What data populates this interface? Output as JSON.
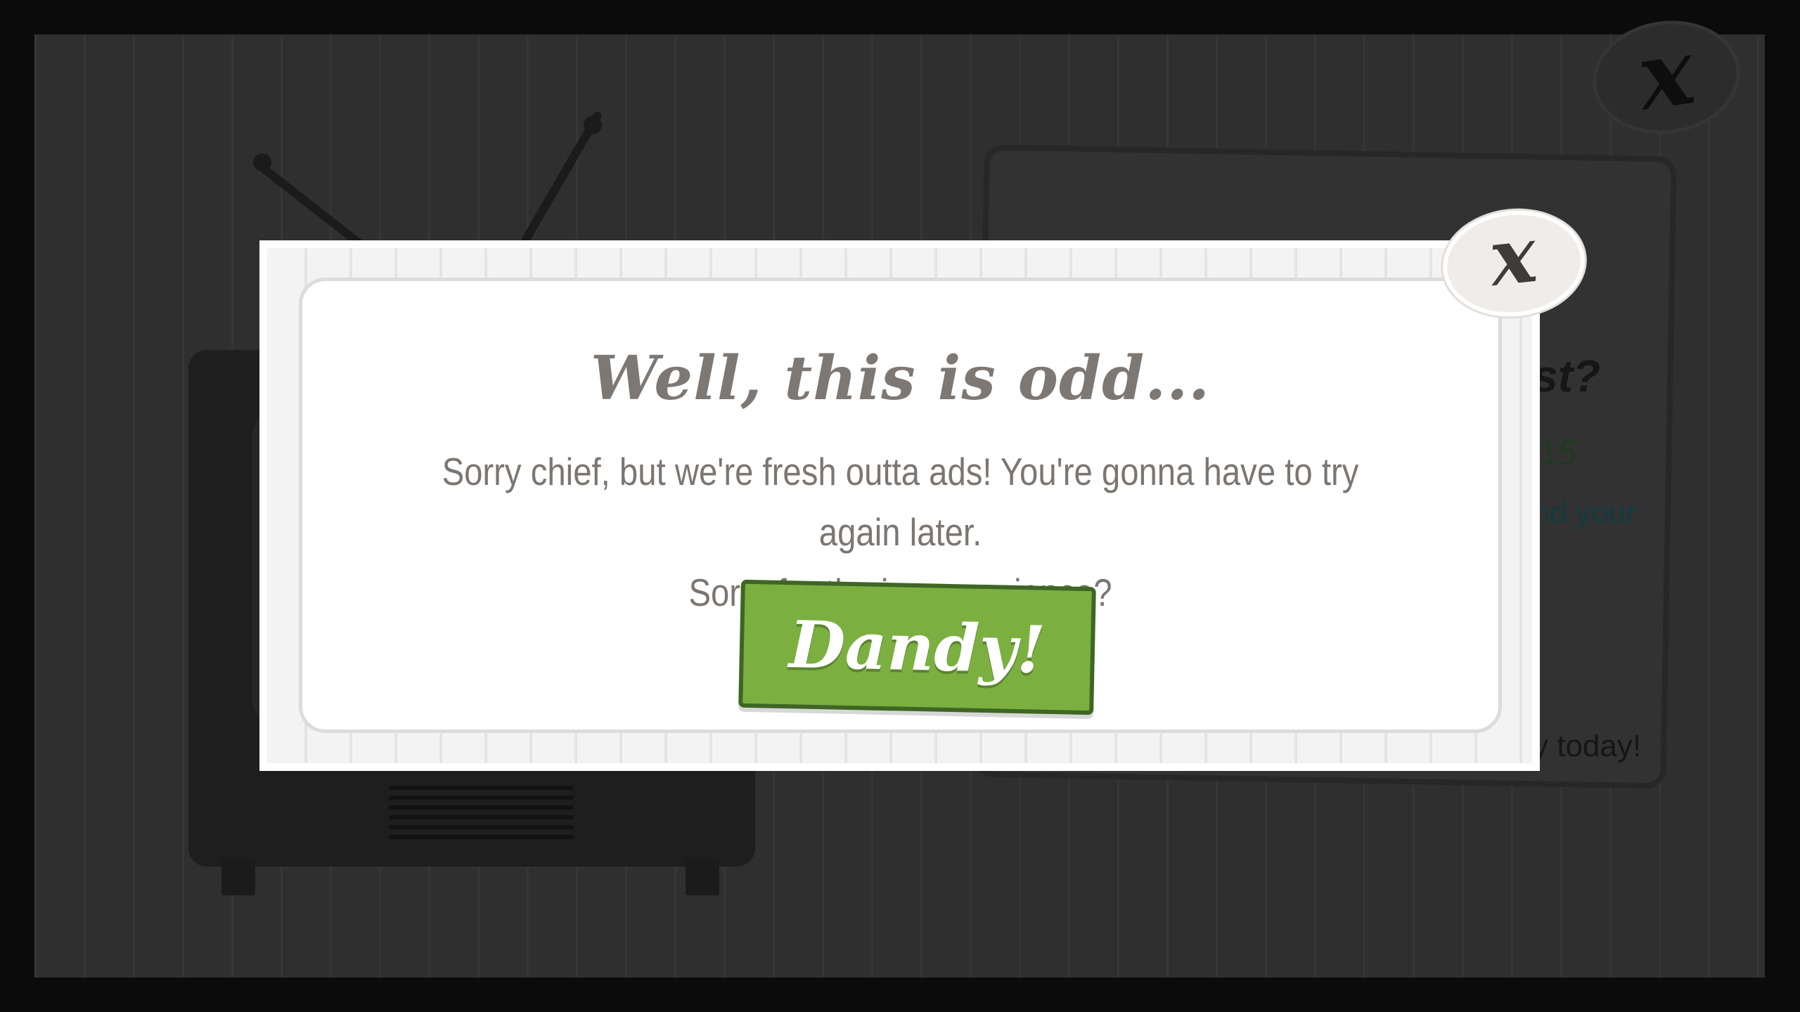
{
  "background": {
    "close_glyph": "x",
    "card_fragments": {
      "question_tail": "st?",
      "number": "15",
      "link_fragment": "nd your",
      "footer_fragment": "y today!"
    }
  },
  "dialog": {
    "title": "Well, this is odd...",
    "message_line1": "Sorry chief, but we're fresh outta ads! You're gonna have to try again later.",
    "message_line2": "Sorry for the inconvenience?",
    "confirm_label": "Dandy!",
    "close_glyph": "x"
  },
  "colors": {
    "button_green": "#7bb041",
    "text_gray": "#7c7672",
    "overlay": "#2f2f2f"
  }
}
